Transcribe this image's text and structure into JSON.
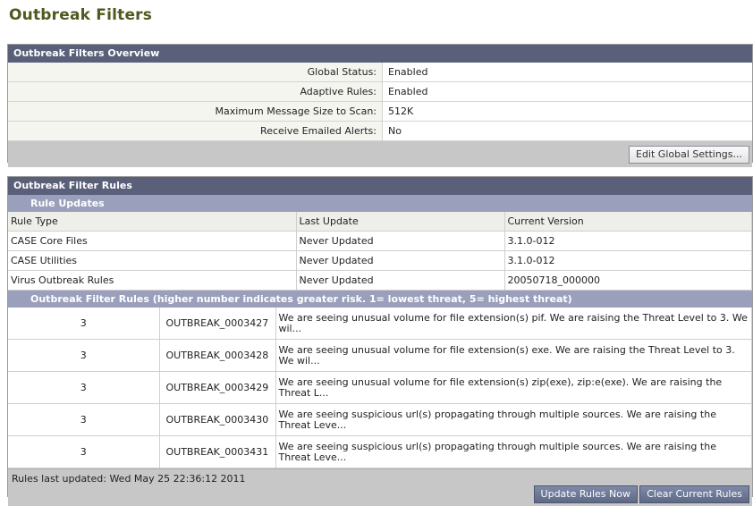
{
  "page": {
    "title": "Outbreak Filters"
  },
  "overview": {
    "header": "Outbreak Filters Overview",
    "rows": [
      {
        "label": "Global Status:",
        "value": "Enabled"
      },
      {
        "label": "Adaptive Rules:",
        "value": "Enabled"
      },
      {
        "label": "Maximum Message Size to Scan:",
        "value": "512K"
      },
      {
        "label": "Receive Emailed Alerts:",
        "value": "No"
      }
    ],
    "edit_button": "Edit Global Settings..."
  },
  "rules": {
    "header": "Outbreak Filter Rules",
    "updates_header": "Rule Updates",
    "update_columns": [
      "Rule Type",
      "Last Update",
      "Current Version"
    ],
    "updates": [
      {
        "type": "CASE Core Files",
        "last": "Never Updated",
        "version": "3.1.0-012"
      },
      {
        "type": "CASE Utilities",
        "last": "Never Updated",
        "version": "3.1.0-012"
      },
      {
        "type": "Virus Outbreak Rules",
        "last": "Never Updated",
        "version": "20050718_000000"
      }
    ],
    "filters_header": "Outbreak Filter Rules (higher number indicates greater risk. 1= lowest threat, 5= highest threat)",
    "filters": [
      {
        "level": "3",
        "name": "OUTBREAK_0003427",
        "desc": "We are seeing unusual volume for file extension(s) pif. We are raising the Threat Level to 3. We wil..."
      },
      {
        "level": "3",
        "name": "OUTBREAK_0003428",
        "desc": "We are seeing unusual volume for file extension(s) exe. We are raising the Threat Level to 3. We wil..."
      },
      {
        "level": "3",
        "name": "OUTBREAK_0003429",
        "desc": "We are seeing unusual volume for file extension(s) zip(exe), zip:e(exe). We are raising the Threat L..."
      },
      {
        "level": "3",
        "name": "OUTBREAK_0003430",
        "desc": "We are seeing suspicious url(s) propagating through multiple sources. We are raising the Threat Leve..."
      },
      {
        "level": "3",
        "name": "OUTBREAK_0003431",
        "desc": "We are seeing suspicious url(s) propagating through multiple sources. We are raising the Threat Leve..."
      }
    ],
    "last_updated": "Rules last updated: Wed May 25 22:36:12 2011",
    "update_button": "Update Rules Now",
    "clear_button": "Clear Current Rules"
  },
  "colors": {
    "header": "#5a607a",
    "subheader": "#9aa0bb",
    "title": "#4f5a1e",
    "button_blue": "#6b7593"
  }
}
